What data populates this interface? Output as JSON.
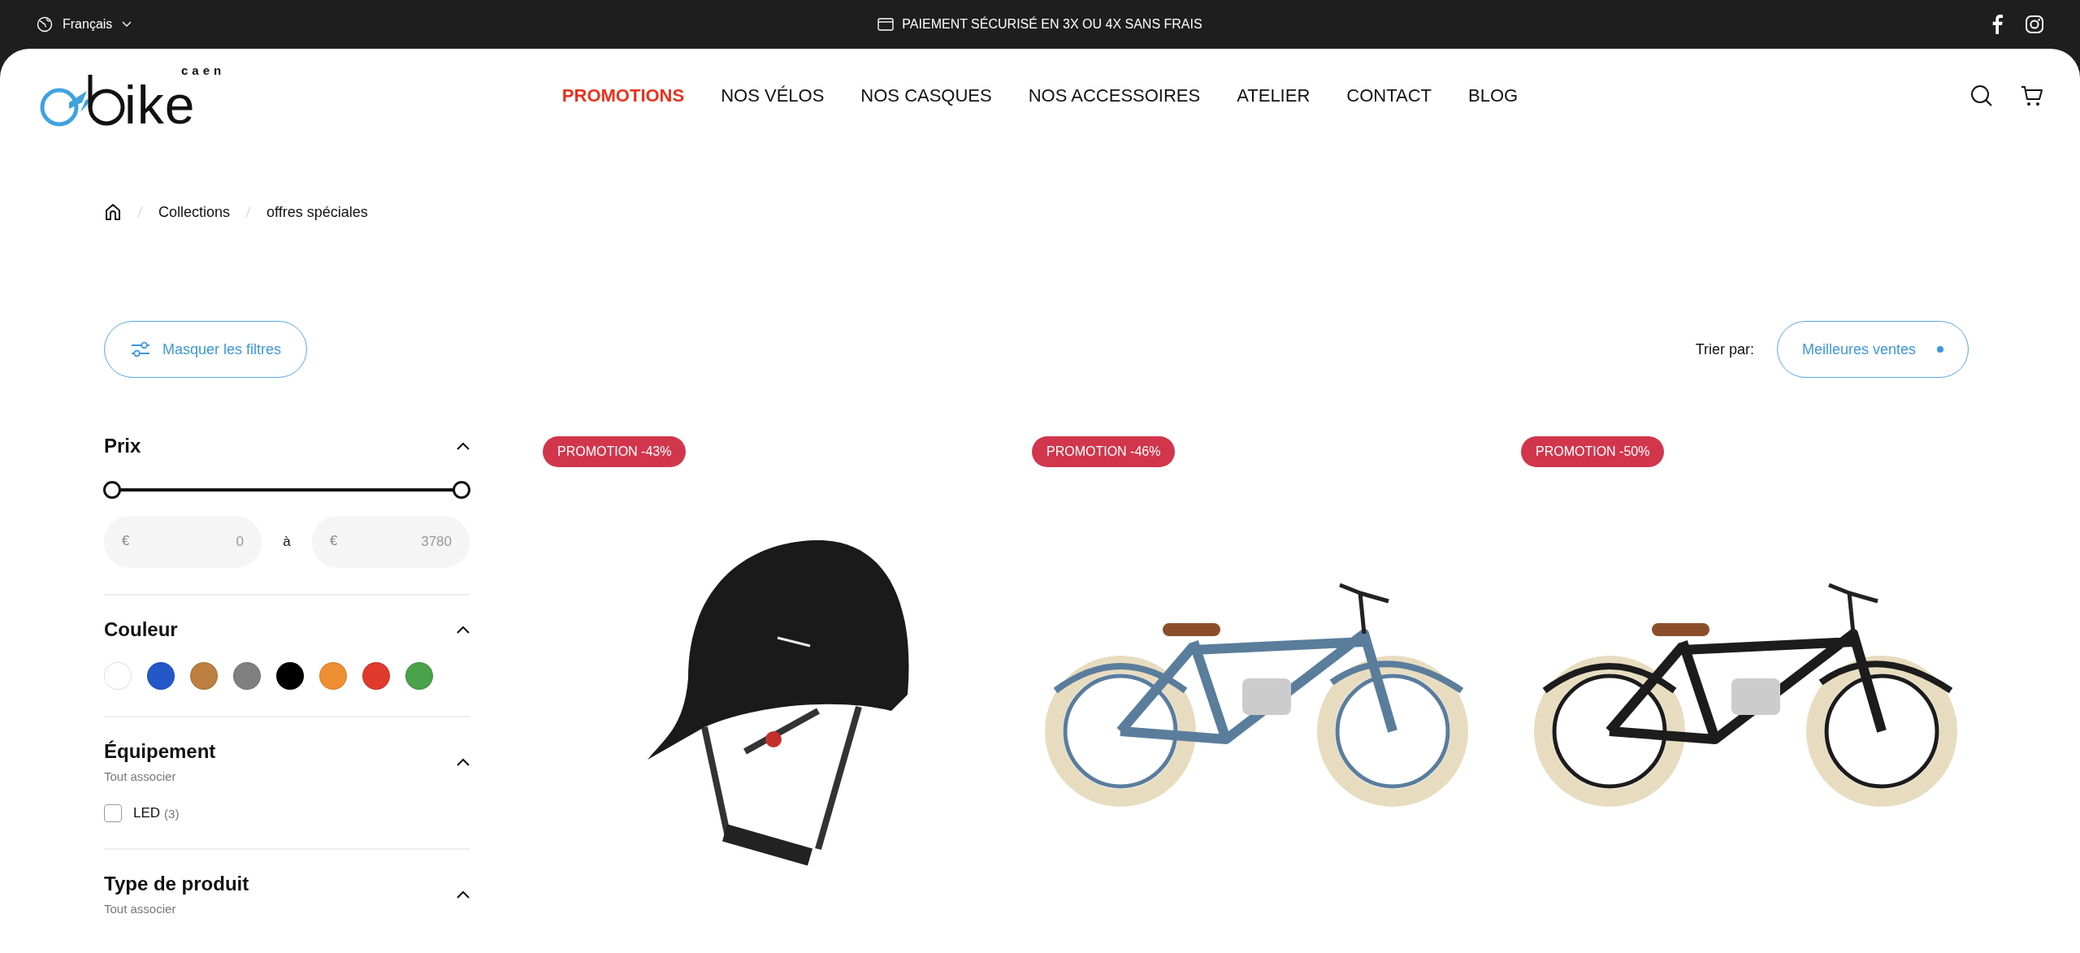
{
  "top_bar": {
    "language": "Français",
    "announcement": "PAIEMENT SÉCURISÉ EN 3X OU 4X SANS FRAIS"
  },
  "header": {
    "logo_word": "ike",
    "logo_city": "caen",
    "nav": [
      {
        "label": "PROMOTIONS",
        "selected": true
      },
      {
        "label": "NOS VÉLOS",
        "selected": false
      },
      {
        "label": "NOS CASQUES",
        "selected": false
      },
      {
        "label": "NOS ACCESSOIRES",
        "selected": false
      },
      {
        "label": "ATELIER",
        "selected": false
      },
      {
        "label": "CONTACT",
        "selected": false
      },
      {
        "label": "BLOG",
        "selected": false
      }
    ]
  },
  "breadcrumb": [
    "Collections",
    "offres spéciales"
  ],
  "filter_toggle": "Masquer les filtres",
  "sort": {
    "label": "Trier par:",
    "value": "Meilleures ventes"
  },
  "filters": [
    {
      "kind": "price",
      "title": "Prix",
      "expanded": true,
      "level": 1,
      "currency": "€",
      "min": {
        "placeholder": "0"
      },
      "separator": "à",
      "max": {
        "placeholder": "3780"
      }
    },
    {
      "kind": "color",
      "title": "Couleur",
      "expanded": true,
      "swatches": [
        {
          "color": "#ffffff"
        },
        {
          "color": "#2457c8"
        },
        {
          "color": "#bd7f3f"
        },
        {
          "color": "#808080"
        },
        {
          "color": "#000000"
        },
        {
          "color": "#ee8f33"
        },
        {
          "color": "#e03a2f"
        },
        {
          "color": "#4aa24a"
        }
      ]
    },
    {
      "kind": "checklist",
      "title": "Équipement",
      "subtitle": "Tout associer",
      "expanded": true,
      "options": [
        {
          "label": "LED",
          "count": "(3)",
          "checked": false
        }
      ]
    },
    {
      "kind": "checklist",
      "title": "Type de produit",
      "subtitle": "Tout associer",
      "expanded": true
    }
  ],
  "products": [
    {
      "kind": "helmet",
      "badge": "PROMOTION -43%"
    },
    {
      "kind": "bicycle",
      "badge": "PROMOTION -46%",
      "color": "#5a7d9c"
    },
    {
      "kind": "bicycle",
      "badge": "PROMOTION -50%",
      "color": "#1c1c1c"
    }
  ]
}
